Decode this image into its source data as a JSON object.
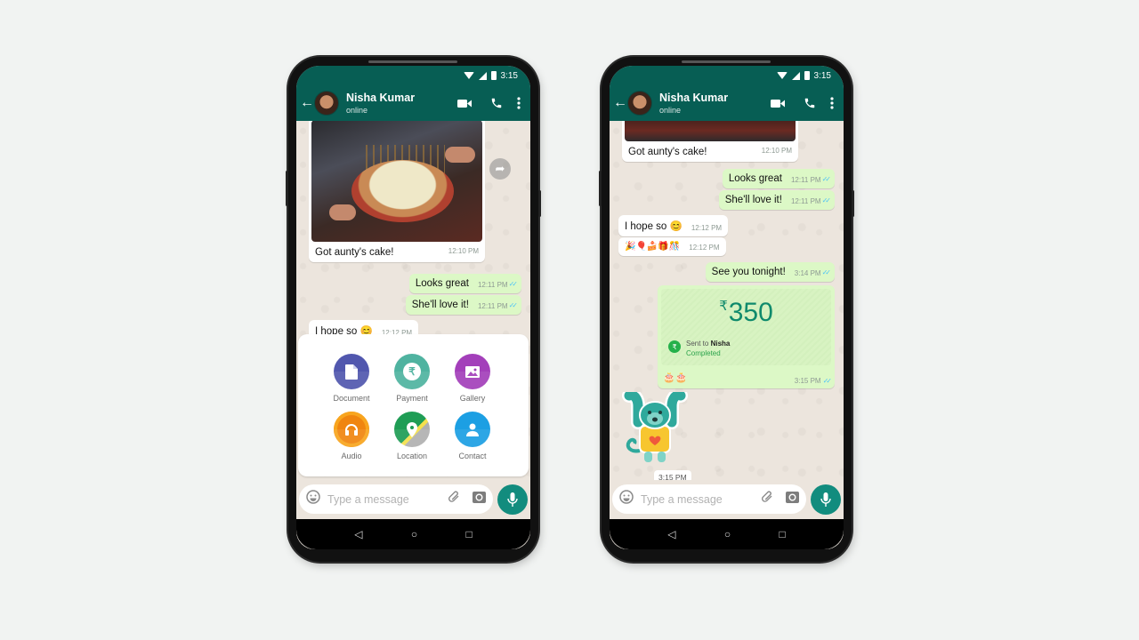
{
  "colors": {
    "header": "#075e54",
    "accent": "#128c7e",
    "incoming_bubble": "#ffffff",
    "outgoing_bubble": "#dcf8c6",
    "chat_bg": "#ece5dd",
    "read_ticks": "#4fc3f7",
    "payment_amount": "#0f8a6c",
    "payment_status": "#2ba34b"
  },
  "phones": [
    {
      "status_bar": {
        "time": "3:15",
        "icons": [
          "wifi-icon",
          "signal-icon",
          "battery-icon"
        ]
      },
      "header": {
        "back_icon": "←",
        "contact_name": "Nisha Kumar",
        "presence": "online",
        "actions": [
          "video-call-icon",
          "voice-call-icon",
          "more-options-icon"
        ]
      },
      "messages": [
        {
          "direction": "in",
          "type": "image",
          "caption": "Got aunty's cake!",
          "time": "12:10 PM"
        },
        {
          "direction": "out",
          "text": "Looks great",
          "time": "12:11 PM",
          "ticks": "✓✓"
        },
        {
          "direction": "out",
          "text": "She'll love it!",
          "time": "12:11 PM",
          "ticks": "✓✓"
        },
        {
          "direction": "in",
          "text": "I hope so 😊",
          "time": "12:12 PM"
        }
      ],
      "attach_menu": [
        {
          "label": "Document",
          "icon": "document-icon",
          "color": "#5157ae"
        },
        {
          "label": "Payment",
          "icon": "rupee-icon",
          "color": "#4fb3a0"
        },
        {
          "label": "Gallery",
          "icon": "gallery-icon",
          "color": "#a33fba"
        },
        {
          "label": "Audio",
          "icon": "headphones-icon",
          "color": "#f0850f"
        },
        {
          "label": "Location",
          "icon": "location-icon",
          "color": "#1f9d55"
        },
        {
          "label": "Contact",
          "icon": "contact-icon",
          "color": "#1c9fe3"
        }
      ],
      "input": {
        "placeholder": "Type a message"
      },
      "nav": {
        "back": "◁",
        "home": "○",
        "recents": "□"
      }
    },
    {
      "status_bar": {
        "time": "3:15",
        "icons": [
          "wifi-icon",
          "signal-icon",
          "battery-icon"
        ]
      },
      "header": {
        "back_icon": "←",
        "contact_name": "Nisha Kumar",
        "presence": "online",
        "actions": [
          "video-call-icon",
          "voice-call-icon",
          "more-options-icon"
        ]
      },
      "messages": [
        {
          "direction": "in",
          "type": "image",
          "caption": "Got aunty's cake!",
          "time": "12:10 PM"
        },
        {
          "direction": "out",
          "text": "Looks great",
          "time": "12:11 PM",
          "ticks": "✓✓"
        },
        {
          "direction": "out",
          "text": "She'll love it!",
          "time": "12:11 PM",
          "ticks": "✓✓"
        },
        {
          "direction": "in",
          "text": "I hope so 😊",
          "time": "12:12 PM"
        },
        {
          "direction": "in",
          "text": "🎉🎈🍰🎁🎊",
          "time": "12:12 PM"
        },
        {
          "direction": "out",
          "text": "See you tonight!",
          "time": "3:14 PM",
          "ticks": "✓✓"
        },
        {
          "direction": "out",
          "type": "payment",
          "currency": "₹",
          "amount": "350",
          "sent_to_prefix": "Sent to",
          "recipient": "Nisha",
          "status": "Completed",
          "emojis": "🎂🎂",
          "time": "3:15 PM",
          "ticks": "✓✓"
        },
        {
          "direction": "in",
          "type": "sticker",
          "sticker": "monkey-sticker",
          "time": "3:15 PM"
        }
      ],
      "input": {
        "placeholder": "Type a message"
      },
      "nav": {
        "back": "◁",
        "home": "○",
        "recents": "□"
      }
    }
  ]
}
